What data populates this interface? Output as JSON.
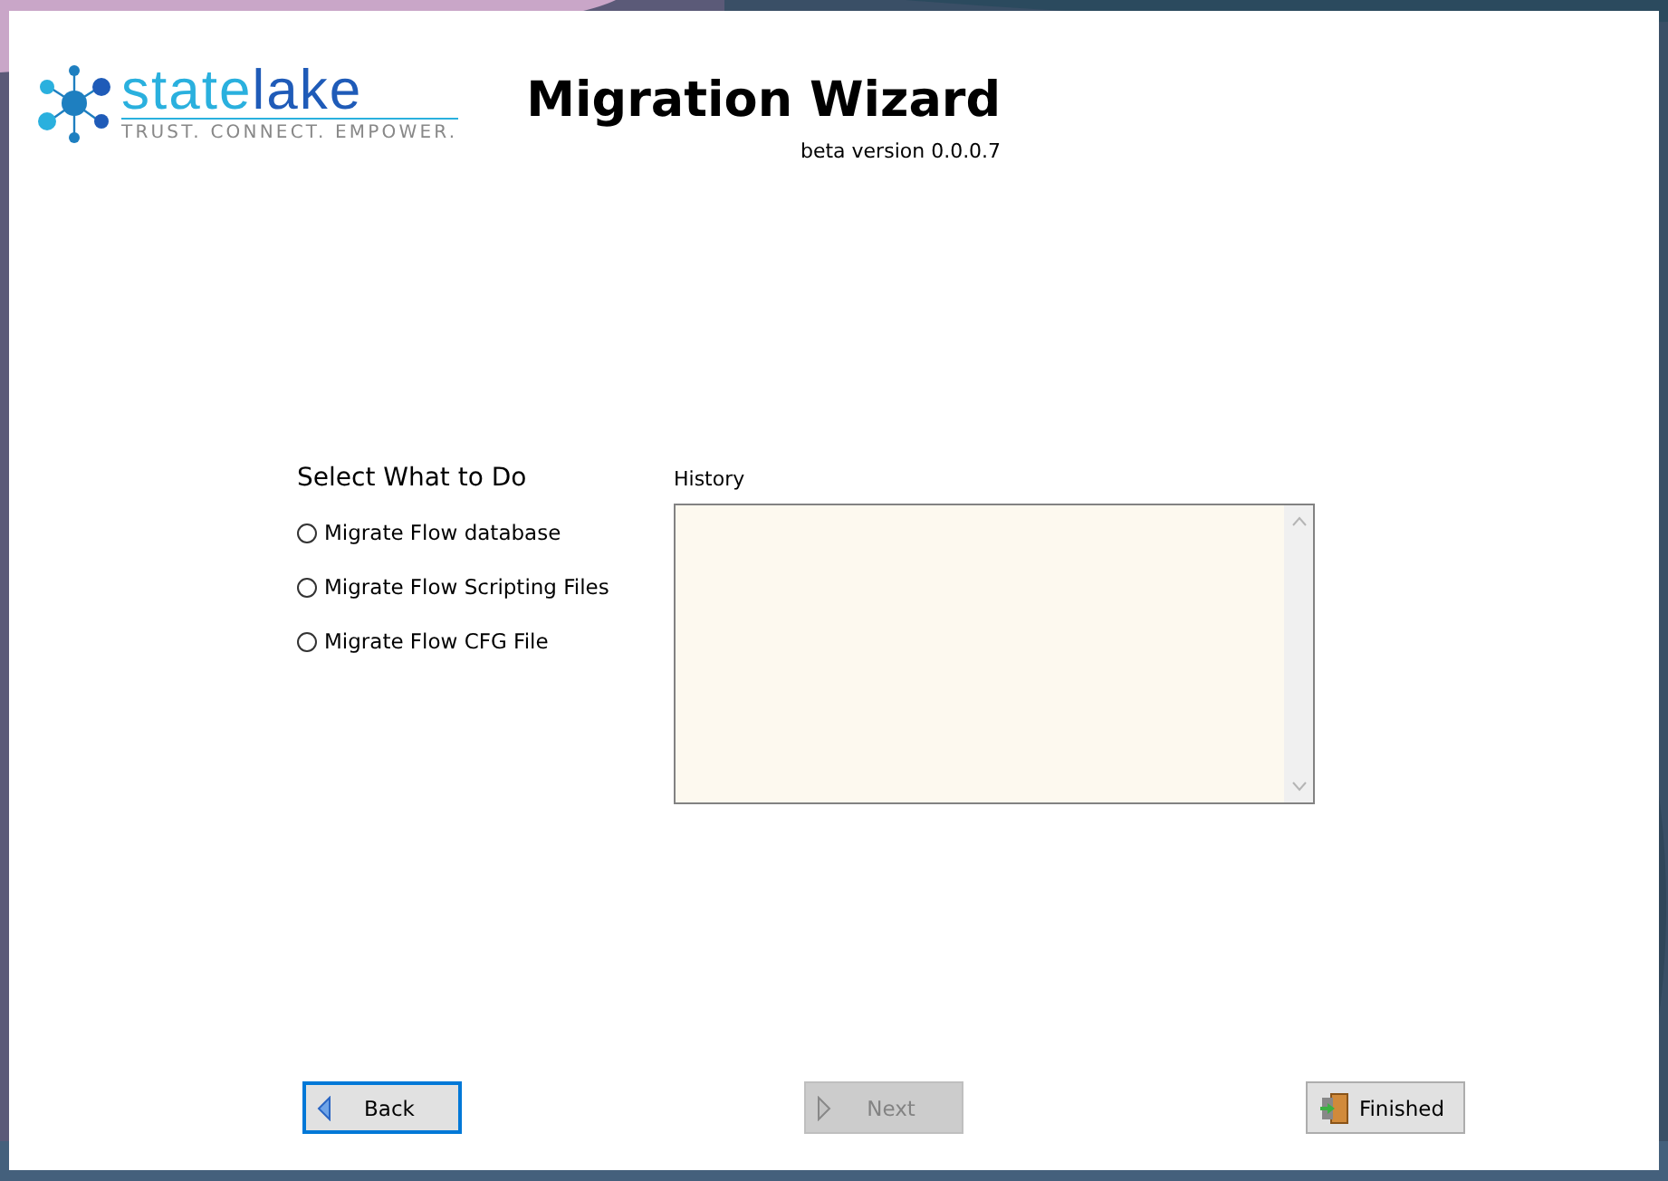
{
  "logo": {
    "word_parts": [
      "state",
      "lake"
    ],
    "tagline": "TRUST. CONNECT. EMPOWER."
  },
  "title": "Migration Wizard",
  "version": "beta version 0.0.0.7",
  "tasks": {
    "heading": "Select What to Do",
    "options": [
      {
        "label": "Migrate Flow database",
        "selected": false
      },
      {
        "label": "Migrate Flow Scripting Files",
        "selected": false
      },
      {
        "label": "Migrate Flow CFG File",
        "selected": false
      }
    ]
  },
  "history": {
    "label": "History"
  },
  "buttons": [
    {
      "kind": "back",
      "label": "Back",
      "disabled": false,
      "focused": true
    },
    {
      "kind": "next",
      "label": "Next",
      "disabled": true,
      "focused": false
    },
    {
      "kind": "finish",
      "label": "Finished",
      "disabled": false,
      "focused": false
    }
  ]
}
